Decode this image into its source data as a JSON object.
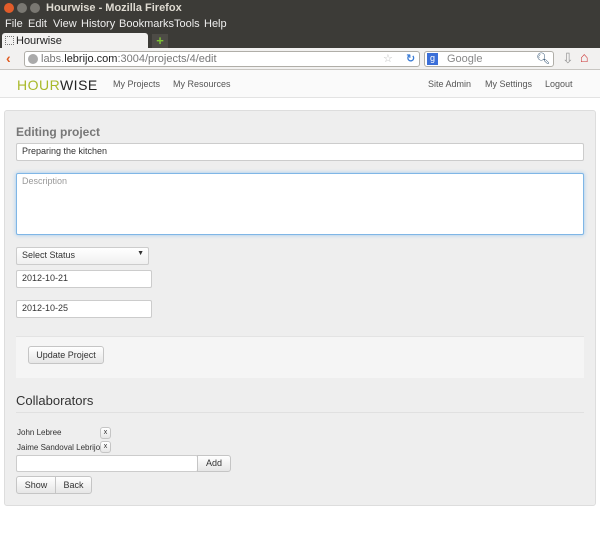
{
  "window": {
    "title": "Hourwise - Mozilla Firefox"
  },
  "menu": [
    "File",
    "Edit",
    "View",
    "History",
    "Bookmarks",
    "Tools",
    "Help"
  ],
  "tab": {
    "label": "Hourwise"
  },
  "url": {
    "host_pre": "labs.",
    "host": "lebrijo.com",
    "rest": ":3004/projects/4/edit"
  },
  "search": {
    "placeholder": "Google"
  },
  "app": {
    "logo": "HOURWISE",
    "nav_left": [
      "My Projects",
      "My Resources"
    ],
    "nav_right": [
      "Site Admin",
      "My Settings",
      "Logout"
    ]
  },
  "form": {
    "heading": "Editing project",
    "name": "Preparing the kitchen",
    "description_placeholder": "Description",
    "status": "Select Status",
    "start_date": "2012-10-21",
    "end_date": "2012-10-25",
    "submit": "Update Project"
  },
  "collaborators": {
    "heading": "Collaborators",
    "people": [
      "John Lebree",
      "Jaime Sandoval Lebrijo"
    ],
    "remove": "x",
    "add": "Add",
    "show": "Show",
    "back": "Back"
  }
}
